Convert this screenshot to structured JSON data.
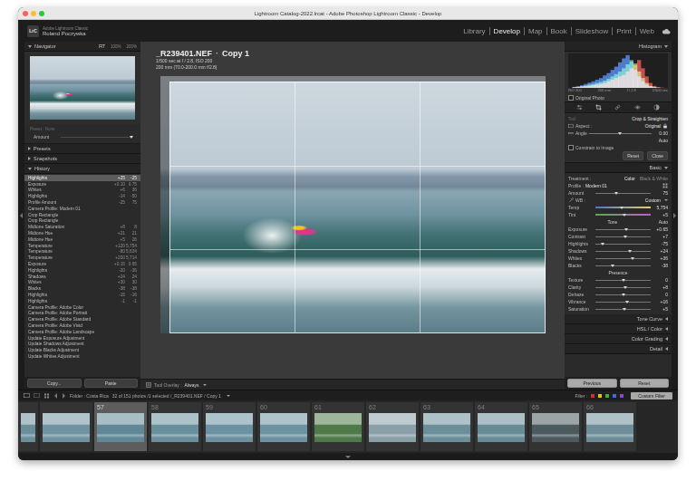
{
  "window": {
    "title": "Lightroom Catalog-2022.lrcat - Adobe Photoshop Lightroom Classic - Develop"
  },
  "identity": {
    "logo": "LrC",
    "app": "Adobe Lightroom Classic",
    "user": "Roland Poczywka"
  },
  "modules": [
    {
      "label": "Library",
      "selected": false
    },
    {
      "label": "Develop",
      "selected": true
    },
    {
      "label": "Map",
      "selected": false
    },
    {
      "label": "Book",
      "selected": false
    },
    {
      "label": "Slideshow",
      "selected": false
    },
    {
      "label": "Print",
      "selected": false
    },
    {
      "label": "Web",
      "selected": false
    }
  ],
  "left_panel": {
    "navigator": {
      "title": "Navigator",
      "expanded": true,
      "zoom": [
        {
          "label": "FIT",
          "selected": true
        },
        {
          "label": "100%",
          "selected": false
        },
        {
          "label": "200%",
          "selected": false
        }
      ]
    },
    "preset": {
      "label": "Preset : None",
      "amount_label": "Amount",
      "level": 1
    },
    "sections": [
      {
        "title": "Presets",
        "expanded": false
      },
      {
        "title": "Snapshots",
        "expanded": false
      },
      {
        "title": "History",
        "expanded": true
      }
    ],
    "history": [
      {
        "label": "Highlights",
        "delta": "+25",
        "value": "-25",
        "selected": true
      },
      {
        "label": "Exposure",
        "delta": "+0.10",
        "value": "0.75",
        "selected": false
      },
      {
        "label": "Whites",
        "delta": "+6",
        "value": "36",
        "selected": false
      },
      {
        "label": "Highlights",
        "delta": "-14",
        "value": "-50",
        "selected": false
      },
      {
        "label": "Profile Amount",
        "delta": "-25",
        "value": "75",
        "selected": false
      },
      {
        "label": "Camera Profile: Modern 01",
        "delta": "",
        "value": "",
        "selected": false
      },
      {
        "label": "Crop Rectangle",
        "delta": "",
        "value": "",
        "selected": false
      },
      {
        "label": "Crop Rectangle",
        "delta": "",
        "value": "",
        "selected": false
      },
      {
        "label": "Midtone Saturation",
        "delta": "+8",
        "value": "8",
        "selected": false
      },
      {
        "label": "Midtone Hue",
        "delta": "+21",
        "value": "21",
        "selected": false
      },
      {
        "label": "Midtone Hue",
        "delta": "+5",
        "value": "26",
        "selected": false
      },
      {
        "label": "Temperature",
        "delta": "+120",
        "value": "5,754",
        "selected": false
      },
      {
        "label": "Temperature",
        "delta": "-80",
        "value": "5,634",
        "selected": false
      },
      {
        "label": "Temperature",
        "delta": "+200",
        "value": "5,714",
        "selected": false
      },
      {
        "label": "Exposure",
        "delta": "+0.15",
        "value": "0.65",
        "selected": false
      },
      {
        "label": "Highlights",
        "delta": "-20",
        "value": "-36",
        "selected": false
      },
      {
        "label": "Shadows",
        "delta": "+24",
        "value": "24",
        "selected": false
      },
      {
        "label": "Whites",
        "delta": "+30",
        "value": "30",
        "selected": false
      },
      {
        "label": "Blacks",
        "delta": "-38",
        "value": "-38",
        "selected": false
      },
      {
        "label": "Highlights",
        "delta": "-15",
        "value": "-16",
        "selected": false
      },
      {
        "label": "Highlights",
        "delta": "-1",
        "value": "-1",
        "selected": false
      },
      {
        "label": "Camera Profile: Adobe Color",
        "delta": "",
        "value": "",
        "selected": false
      },
      {
        "label": "Camera Profile: Adobe Portrait",
        "delta": "",
        "value": "",
        "selected": false
      },
      {
        "label": "Camera Profile: Adobe Standard",
        "delta": "",
        "value": "",
        "selected": false
      },
      {
        "label": "Camera Profile: Adobe Vivid",
        "delta": "",
        "value": "",
        "selected": false
      },
      {
        "label": "Camera Profile: Adobe Landscape",
        "delta": "",
        "value": "",
        "selected": false
      },
      {
        "label": "Update Exposure Adjustment",
        "delta": "",
        "value": "",
        "selected": false
      },
      {
        "label": "Update Shadows Adjustment",
        "delta": "",
        "value": "",
        "selected": false
      },
      {
        "label": "Update Blacks Adjustment",
        "delta": "",
        "value": "",
        "selected": false
      },
      {
        "label": "Update Whites Adjustment",
        "delta": "",
        "value": "",
        "selected": false
      }
    ],
    "buttons": [
      "Copy...",
      "Paste"
    ]
  },
  "photo": {
    "filename": "_R239401.NEF",
    "separator": "·",
    "copy": "Copy 1",
    "exposure": "1/500 sec at f / 2.8, ISO 200",
    "lens": "200 mm (70.0-200.0 mm f/2.8)"
  },
  "toolbar": {
    "label": "Tool Overlay :",
    "value": "Always"
  },
  "histogram": {
    "title": "Histogram",
    "expanded": true,
    "series": [
      {
        "name": "red",
        "color": "#e2403e",
        "values": [
          0.02,
          0.03,
          0.04,
          0.05,
          0.06,
          0.08,
          0.1,
          0.12,
          0.15,
          0.2,
          0.25,
          0.3,
          0.35,
          0.4,
          0.5,
          0.6,
          0.7,
          0.85,
          0.6,
          0.35,
          0.15,
          0.06,
          0.02,
          0.01
        ]
      },
      {
        "name": "green",
        "color": "#49c24a",
        "values": [
          0.02,
          0.03,
          0.05,
          0.07,
          0.1,
          0.12,
          0.15,
          0.18,
          0.22,
          0.28,
          0.35,
          0.42,
          0.5,
          0.6,
          0.72,
          0.85,
          0.75,
          0.5,
          0.3,
          0.15,
          0.06,
          0.03,
          0.01,
          0.0
        ]
      },
      {
        "name": "blue",
        "color": "#3d7ae6",
        "values": [
          0.03,
          0.05,
          0.08,
          0.12,
          0.16,
          0.2,
          0.25,
          0.3,
          0.38,
          0.45,
          0.55,
          0.65,
          0.78,
          0.9,
          1.0,
          0.8,
          0.55,
          0.35,
          0.2,
          0.1,
          0.05,
          0.02,
          0.01,
          0.0
        ]
      }
    ],
    "info": [
      "ISO 200",
      "200 mm",
      "f / 2.8",
      "1/500 sec"
    ],
    "original_photo": {
      "label": "Original Photo",
      "checked": false
    }
  },
  "tools": [
    {
      "kind": "edit",
      "selected": false
    },
    {
      "kind": "crop",
      "selected": true
    },
    {
      "kind": "heal",
      "selected": false
    },
    {
      "kind": "redeye",
      "selected": false
    },
    {
      "kind": "mask",
      "selected": false
    }
  ],
  "crop": {
    "tool": "Tool",
    "title": "Crop & Straighten",
    "aspect_label": "Aspect :",
    "aspect": "Original",
    "locked": true,
    "angle_label": "Angle",
    "angle": "0.00",
    "angle_level": 0.5,
    "auto": "Auto",
    "constrain": {
      "label": "Constrain to Image",
      "checked": false
    },
    "buttons": [
      "Reset",
      "Close"
    ]
  },
  "basic": {
    "title": "Basic",
    "expanded": true,
    "treatment_label": "Treatment :",
    "treatments": [
      {
        "label": "Color",
        "selected": true
      },
      {
        "label": "Black & White",
        "selected": false
      }
    ],
    "profile": {
      "label": "Profile :",
      "value": "Modern 01"
    },
    "amount": {
      "label": "Amount",
      "level": 0.375,
      "reading": "75"
    },
    "white_balance": {
      "label": "WB :",
      "value": "Custom",
      "sliders": [
        {
          "label": "Temp",
          "kind": "temp",
          "level": 0.48,
          "reading": "5,754"
        },
        {
          "label": "Tint",
          "kind": "tint",
          "level": 0.52,
          "reading": "+5"
        }
      ]
    },
    "tone": {
      "label": "Tone",
      "auto": "Auto",
      "sliders": [
        {
          "label": "Exposure",
          "kind": "plain",
          "level": 0.565,
          "reading": "+0.65"
        },
        {
          "label": "Contrast",
          "kind": "plain",
          "level": 0.535,
          "reading": "+7"
        },
        {
          "label": "Highlights",
          "kind": "plain",
          "level": 0.125,
          "reading": "-75"
        },
        {
          "label": "Shadows",
          "kind": "plain",
          "level": 0.62,
          "reading": "+24"
        },
        {
          "label": "Whites",
          "kind": "plain",
          "level": 0.68,
          "reading": "+36"
        },
        {
          "label": "Blacks",
          "kind": "plain",
          "level": 0.31,
          "reading": "-38"
        }
      ]
    },
    "presence": {
      "label": "Presence",
      "sliders": [
        {
          "label": "Texture",
          "kind": "plain",
          "level": 0.5,
          "reading": "0"
        },
        {
          "label": "Clarity",
          "kind": "plain",
          "level": 0.54,
          "reading": "+8"
        },
        {
          "label": "Dehaze",
          "kind": "plain",
          "level": 0.5,
          "reading": "0"
        },
        {
          "label": "Vibrance",
          "kind": "plain",
          "level": 0.58,
          "reading": "+16"
        },
        {
          "label": "Saturation",
          "kind": "plain",
          "level": 0.525,
          "reading": "+5"
        }
      ]
    }
  },
  "panels": [
    {
      "title": "Tone Curve",
      "expanded": false
    },
    {
      "title": "HSL / Color",
      "expanded": false
    },
    {
      "title": "Color Grading",
      "expanded": false
    },
    {
      "title": "Detail",
      "expanded": false
    }
  ],
  "footer_buttons": [
    "Previous",
    "Reset"
  ],
  "filmstrip": {
    "folder": "Folder : Costa Rica",
    "count": "32 of 151 photos /1 selected /_R239401.NEF / Copy 1",
    "filter": "Filter :",
    "custom_filter": "Custom Filter",
    "label_filters": [
      {
        "color": "#c8332f"
      },
      {
        "color": "#d9c233"
      },
      {
        "color": "#4aa843"
      },
      {
        "color": "#3a6fcf"
      },
      {
        "color": "#8d4bbf"
      }
    ],
    "thumbs": [
      {
        "number": "",
        "selected": false,
        "color": "#6a8f9c"
      },
      {
        "number": "",
        "selected": false,
        "color": "#6f93a0"
      },
      {
        "number": "57",
        "selected": true,
        "color": "#5f8896"
      },
      {
        "number": "58",
        "selected": false,
        "color": "#68909c"
      },
      {
        "number": "59",
        "selected": false,
        "color": "#6a92a0"
      },
      {
        "number": "60",
        "selected": false,
        "color": "#6c93a1"
      },
      {
        "number": "61",
        "selected": false,
        "color": "#4e7a4a"
      },
      {
        "number": "62",
        "selected": false,
        "color": "#8aa0a8"
      },
      {
        "number": "63",
        "selected": false,
        "color": "#6a8f9b"
      },
      {
        "number": "64",
        "selected": false,
        "color": "#678c98"
      },
      {
        "number": "65",
        "selected": false,
        "color": "#4a5a5e"
      },
      {
        "number": "66",
        "selected": false,
        "color": "#6d8e99"
      }
    ]
  }
}
